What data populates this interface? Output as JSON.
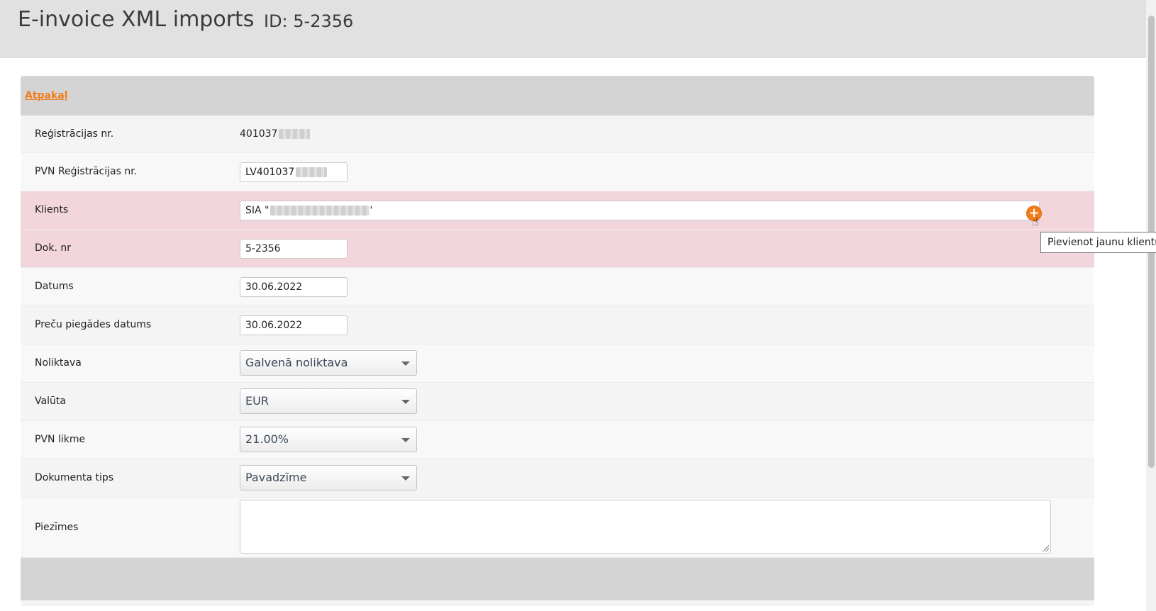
{
  "header": {
    "title": "E-invoice XML imports",
    "doc_id": "ID: 5-2356"
  },
  "card": {
    "back_label": "Atpakaļ"
  },
  "fields": {
    "registration": {
      "label": "Reģistrācijas nr.",
      "value": "401037"
    },
    "vat_registration": {
      "label": "PVN Reģistrācijas nr.",
      "value": "LV401037"
    },
    "client": {
      "label": "Klients",
      "value_prefix": "SIA \"",
      "value_suffix": "'"
    },
    "doc_no": {
      "label": "Dok. nr",
      "value": "5-2356"
    },
    "date": {
      "label": "Datums",
      "value": "30.06.2022"
    },
    "delivery_date": {
      "label": "Preču piegādes datums",
      "value": "30.06.2022"
    },
    "warehouse": {
      "label": "Noliktava",
      "value": "Galvenā noliktava"
    },
    "currency": {
      "label": "Valūta",
      "value": "EUR"
    },
    "vat_rate": {
      "label": "PVN likme",
      "value": "21.00%"
    },
    "doc_type": {
      "label": "Dokumenta tips",
      "value": "Pavadzīme"
    },
    "notes": {
      "label": "Piezīmes",
      "value": ""
    }
  },
  "tooltip": {
    "add_client": "Pievienot jaunu klientu"
  },
  "colors": {
    "accent": "#f07d1a",
    "error_row": "#f3d6dc",
    "header_bg": "#e1e1e1",
    "card_band": "#d4d4d4"
  },
  "icons": {
    "add_client": "plus-circle-icon",
    "cursor": "hand-pointer-icon"
  }
}
